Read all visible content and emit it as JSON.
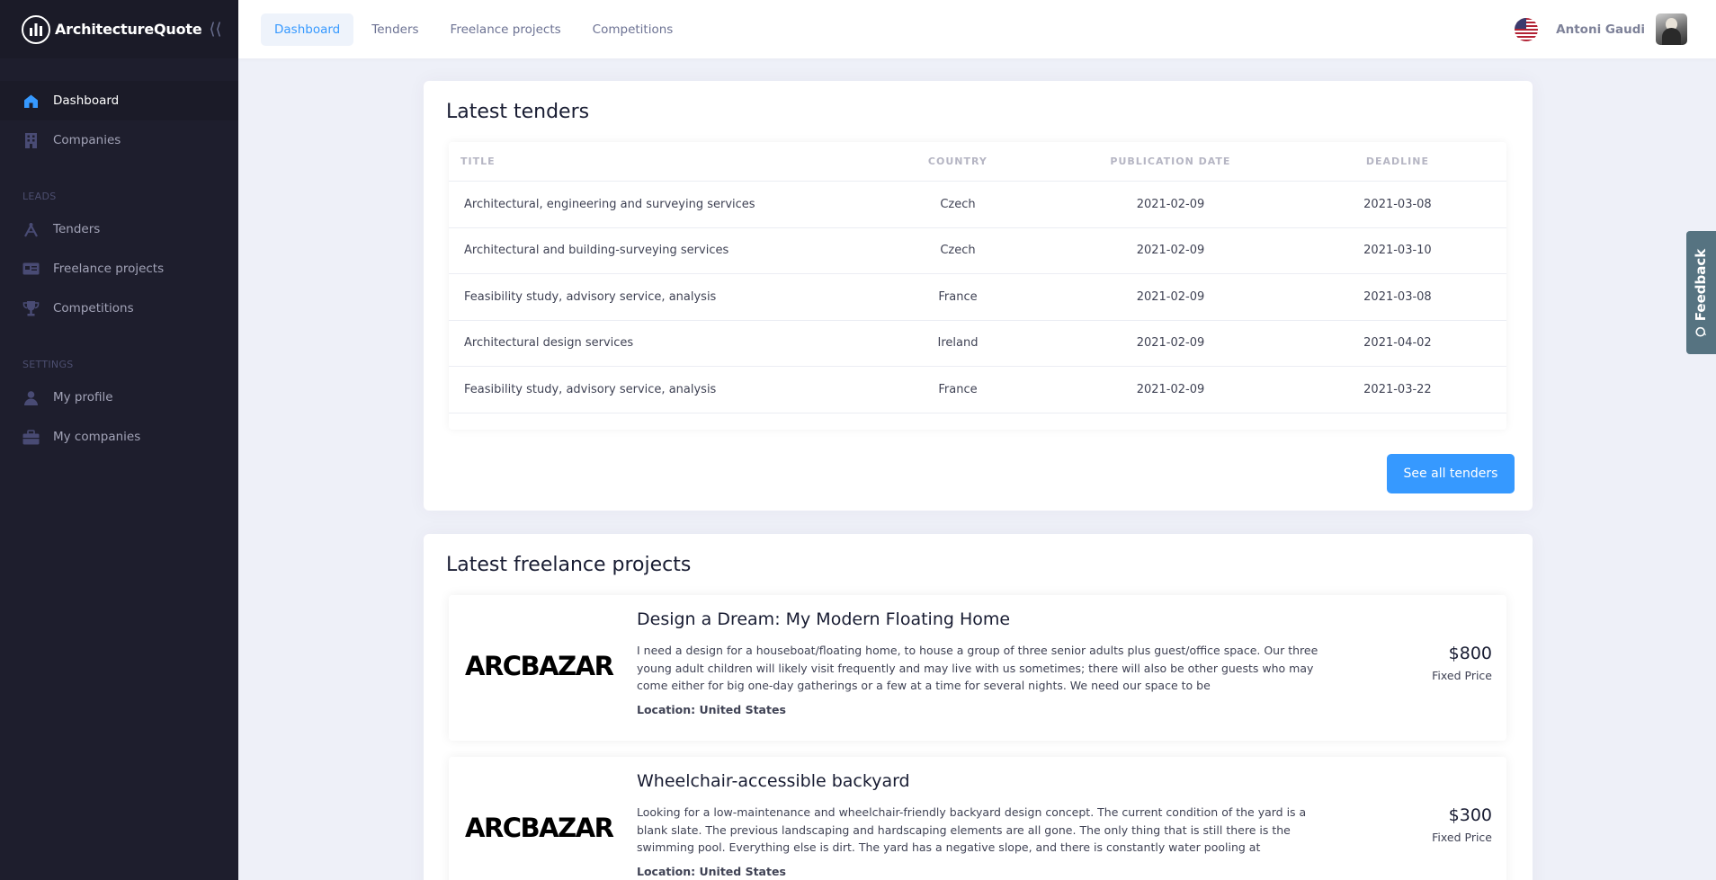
{
  "brand": {
    "name": "ArchitectureQuote"
  },
  "sidebar": {
    "items": [
      {
        "label": "Dashboard",
        "icon": "home-icon"
      },
      {
        "label": "Companies",
        "icon": "building-icon"
      }
    ],
    "leads_section": "LEADS",
    "leads": [
      {
        "label": "Tenders",
        "icon": "compass-icon"
      },
      {
        "label": "Freelance projects",
        "icon": "card-icon"
      },
      {
        "label": "Competitions",
        "icon": "trophy-icon"
      }
    ],
    "settings_section": "SETTINGS",
    "settings": [
      {
        "label": "My profile",
        "icon": "user-icon"
      },
      {
        "label": "My companies",
        "icon": "briefcase-icon"
      }
    ]
  },
  "topnav": [
    "Dashboard",
    "Tenders",
    "Freelance projects",
    "Competitions"
  ],
  "user": {
    "name": "Antoni Gaudi"
  },
  "tenders": {
    "title": "Latest tenders",
    "columns": [
      "TITLE",
      "COUNTRY",
      "PUBLICATION DATE",
      "DEADLINE"
    ],
    "rows": [
      [
        "Architectural, engineering and surveying services",
        "Czech",
        "2021-02-09",
        "2021-03-08"
      ],
      [
        "Architectural and building-surveying services",
        "Czech",
        "2021-02-09",
        "2021-03-10"
      ],
      [
        "Feasibility study, advisory service, analysis",
        "France",
        "2021-02-09",
        "2021-03-08"
      ],
      [
        "Architectural design services",
        "Ireland",
        "2021-02-09",
        "2021-04-02"
      ],
      [
        "Feasibility study, advisory service, analysis",
        "France",
        "2021-02-09",
        "2021-03-22"
      ]
    ],
    "see_all": "See all tenders"
  },
  "freelance": {
    "title": "Latest freelance projects",
    "projects": [
      {
        "logo": "ARCBAZAR",
        "title": "Design a Dream: My Modern Floating Home",
        "description": "I need a design for a houseboat/floating home, to house a group of three senior adults plus guest/office space. Our three young adult children will likely visit frequently and may live with us sometimes; there will also be other guests who may come either for big one-day gatherings or a few at a time for several nights. We need our space to be",
        "location": "Location: United States",
        "price": "$800",
        "price_type": "Fixed Price"
      },
      {
        "logo": "ARCBAZAR",
        "title": "Wheelchair-accessible backyard",
        "description": "Looking for a low-maintenance and wheelchair-friendly backyard design concept. The current condition of the yard is a blank slate. The previous landscaping and hardscaping elements are all gone. The only thing that is still there is the swimming pool. Everything else is dirt. The yard has a negative slope, and there is constantly water pooling at",
        "location": "Location: United States",
        "price": "$300",
        "price_type": "Fixed Price"
      }
    ]
  },
  "feedback": {
    "label": "Feedback"
  },
  "colors": {
    "accent": "#3699ff",
    "sidebar_bg": "#1e1e2d",
    "page_bg": "#eef0f8",
    "feedback_bg": "#567381"
  }
}
